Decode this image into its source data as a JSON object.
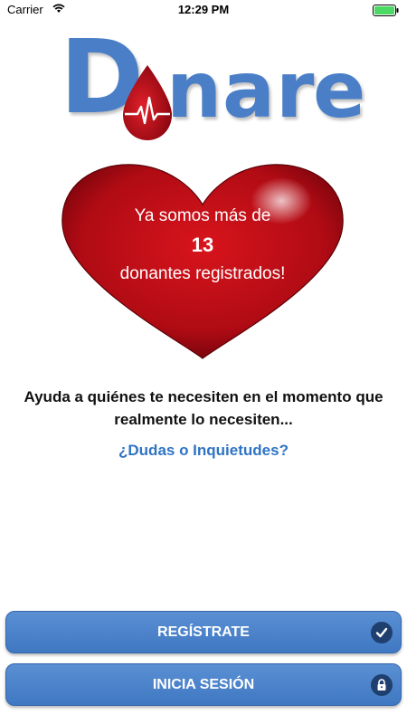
{
  "status_bar": {
    "carrier": "Carrier",
    "time": "12:29 PM"
  },
  "logo": {
    "letters": [
      "D",
      "n",
      "a",
      "r",
      "e"
    ],
    "color": "#4a7fc8"
  },
  "heart": {
    "line1": "Ya somos más de",
    "count": "13",
    "line3": "donantes registrados!",
    "color": "#c8101a"
  },
  "tagline": "Ayuda a quiénes te necesiten en el momento que realmente lo necesiten...",
  "faq_link": "¿Dudas o Inquietudes?",
  "buttons": {
    "register_label": "REGÍSTRATE",
    "login_label": "INICIA SESIÓN"
  },
  "icons": {
    "register": "checkmark-icon",
    "login": "lock-icon"
  },
  "accent_color": "#4a7fc8"
}
